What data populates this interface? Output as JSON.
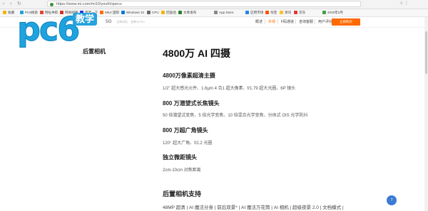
{
  "browser": {
    "url": "https://www.mi.com/mi10/youth/specs",
    "nav_back": "‹",
    "nav_forward": "›",
    "nav_reload": "↻",
    "right_text": "☆ ⋮"
  },
  "bookmarks": [
    {
      "label": "收藏",
      "color": "#f4b400"
    },
    {
      "label": "PC6搜索",
      "color": "#1fa3e0"
    },
    {
      "label": "网址导航",
      "color": "#e94235"
    },
    {
      "label": "网易邮箱",
      "color": "#d93025"
    },
    {
      "label": "百度一下",
      "color": "#2932e1"
    },
    {
      "label": "MIUI 国际",
      "color": "#ff6a00"
    },
    {
      "label": "Windows 10",
      "color": "#0078d7"
    },
    {
      "label": "CPU",
      "color": "#6a6a6a"
    },
    {
      "label": "回复函",
      "color": "#f4b400"
    },
    {
      "label": "文章发布",
      "color": "#2e7d32"
    },
    {
      "label": "App Store",
      "color": "#888888"
    },
    {
      "label": "应用市场",
      "color": "#1e88e5"
    },
    {
      "label": "淘宝",
      "color": "#ff5000"
    },
    {
      "label": "资讯",
      "color": "#fbc02d"
    },
    {
      "label": "京东",
      "color": "#e53935"
    },
    {
      "label": "2020年2月",
      "color": "#43a047"
    }
  ],
  "sitenav": {
    "model": "5G",
    "sub1": "立体对比",
    "sub2": "全新10 Pro",
    "links": [
      "概述",
      "外观",
      "F码通道",
      "咨询客服",
      "用户评价"
    ],
    "active_index": 1,
    "buy_label": "立即购买"
  },
  "watermark": {
    "logo": "pc6",
    "tag": "教学"
  },
  "content": {
    "side_title": "后置相机",
    "main_title": "4800万 AI 四摄",
    "features": [
      {
        "title": "4800万像素超清主摄",
        "desc": "1/2\" 超大感光元件、1.6μm 4 合1 超大像素、f/1.79 超大光圈、6P 镜头"
      },
      {
        "title": "800 万潜望式长焦镜头",
        "desc": "50 倍潜望式变焦、5 倍光学变焦、10 倍混合光学变焦、分体式 OIS 光学防抖"
      },
      {
        "title": "800 万超广角镜头",
        "desc": "120° 超大广角、f/2.2 光圈"
      },
      {
        "title": "独立微距镜头",
        "desc": "2cm-10cm 对焦距离"
      }
    ],
    "support_title": "后置相机支持",
    "support_desc": "48MP 超清 | AI 魔法分身 | 前后双景* | AI 魔法万花筒 | AI 相机 | 超级夜景 2.0 | 文档模式 |"
  },
  "help_label": "?",
  "colors": {
    "accent": "#ff6a00",
    "brand_blue": "#1fa3e0"
  }
}
